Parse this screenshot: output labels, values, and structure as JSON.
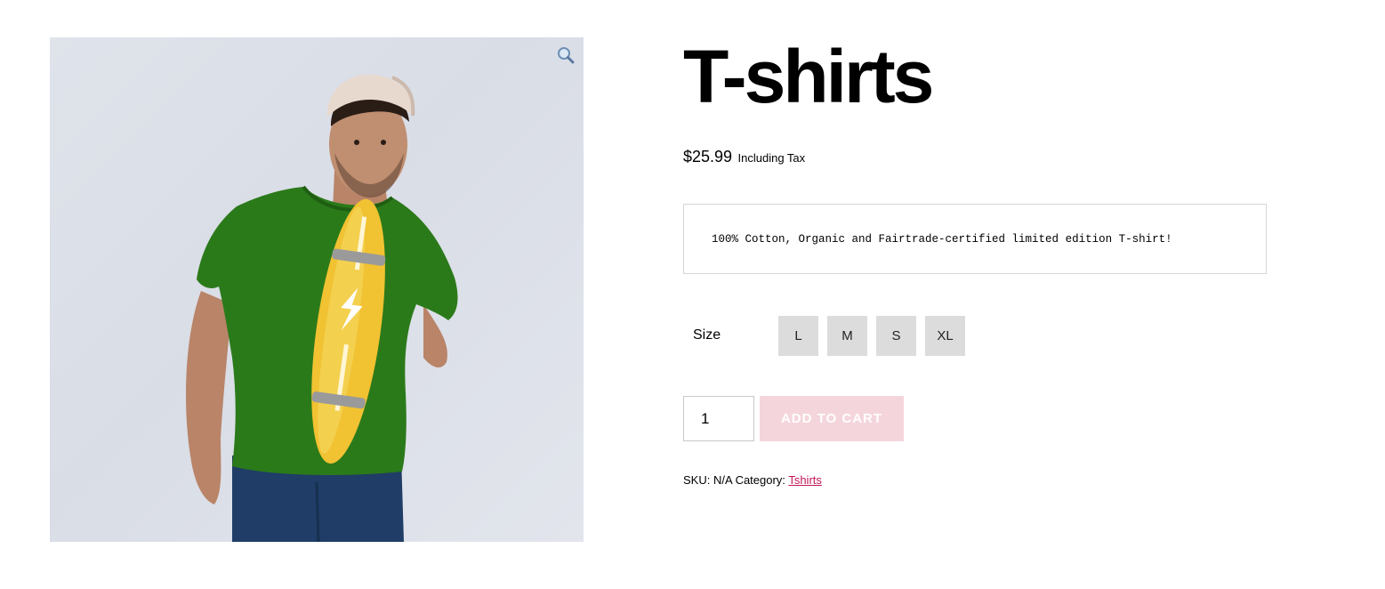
{
  "product": {
    "title": "T-shirts",
    "price": "$25.99",
    "tax_label": "Including Tax",
    "description": "100% Cotton, Organic and Fairtrade-certified limited edition T-shirt!",
    "image_alt": "Man wearing green T-shirt with yellow longboard print",
    "zoom_icon": "magnifier-icon"
  },
  "variations": {
    "label": "Size",
    "options": [
      "L",
      "M",
      "S",
      "XL"
    ]
  },
  "cart": {
    "quantity": "1",
    "add_to_cart_label": "ADD TO CART",
    "button_color": "#f5d5dc"
  },
  "meta": {
    "sku_label": "SKU:",
    "sku_value": "N/A",
    "category_label": "Category:",
    "category_value": "Tshirts",
    "link_color": "#c2185b"
  },
  "colors": {
    "shirt": "#2b7a1a",
    "board": "#f1c232",
    "jeans": "#1f3d66"
  }
}
